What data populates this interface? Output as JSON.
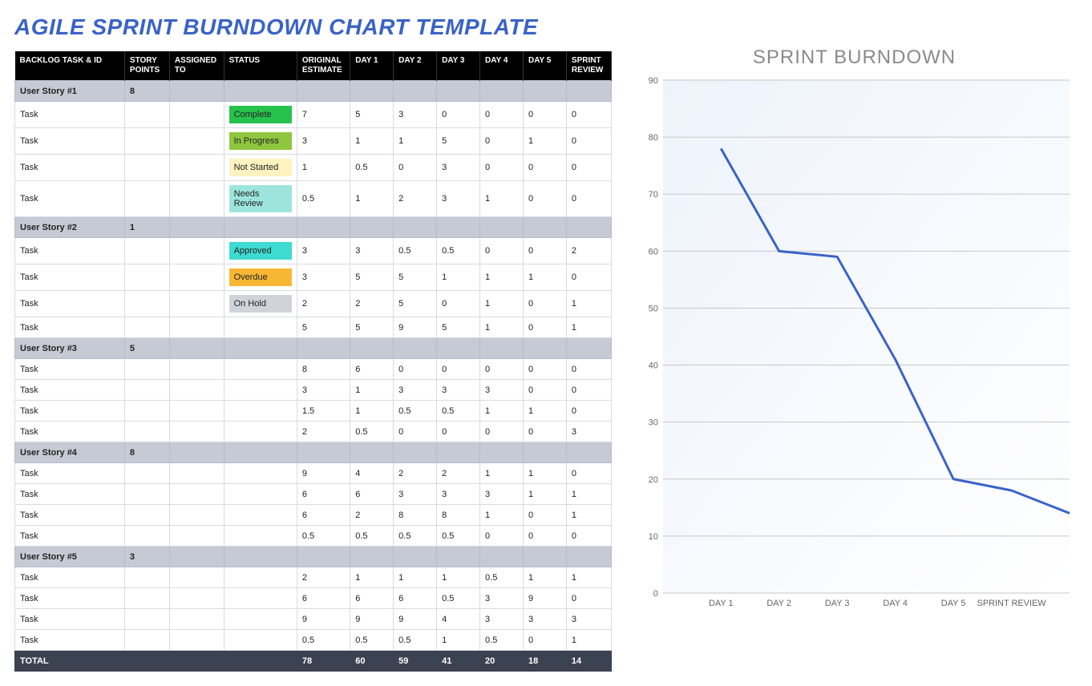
{
  "title": "AGILE SPRINT BURNDOWN CHART TEMPLATE",
  "columns": [
    "BACKLOG TASK & ID",
    "STORY POINTS",
    "ASSIGNED TO",
    "STATUS",
    "ORIGINAL ESTIMATE",
    "DAY 1",
    "DAY 2",
    "DAY 3",
    "DAY 4",
    "DAY 5",
    "SPRINT REVIEW"
  ],
  "status_colors": {
    "Complete": "#27c24c",
    "In Progress": "#8ec63f",
    "Not Started": "#fdf2c0",
    "Needs Review": "#9de5dc",
    "Approved": "#3ddbd1",
    "Overdue": "#f7b733",
    "On Hold": "#d0d3d9"
  },
  "rows": [
    {
      "type": "story",
      "name": "User Story #1",
      "points": "8"
    },
    {
      "type": "task",
      "name": "Task",
      "status": "Complete",
      "vals": [
        "7",
        "5",
        "3",
        "0",
        "0",
        "0",
        "0"
      ]
    },
    {
      "type": "task",
      "name": "Task",
      "status": "In Progress",
      "vals": [
        "3",
        "1",
        "1",
        "5",
        "0",
        "1",
        "0"
      ]
    },
    {
      "type": "task",
      "name": "Task",
      "status": "Not Started",
      "vals": [
        "1",
        "0.5",
        "0",
        "3",
        "0",
        "0",
        "0"
      ]
    },
    {
      "type": "task",
      "name": "Task",
      "status": "Needs Review",
      "vals": [
        "0.5",
        "1",
        "2",
        "3",
        "1",
        "0",
        "0"
      ]
    },
    {
      "type": "story",
      "name": "User Story #2",
      "points": "1"
    },
    {
      "type": "task",
      "name": "Task",
      "status": "Approved",
      "vals": [
        "3",
        "3",
        "0.5",
        "0.5",
        "0",
        "0",
        "2"
      ]
    },
    {
      "type": "task",
      "name": "Task",
      "status": "Overdue",
      "vals": [
        "3",
        "5",
        "5",
        "1",
        "1",
        "1",
        "0"
      ]
    },
    {
      "type": "task",
      "name": "Task",
      "status": "On Hold",
      "vals": [
        "2",
        "2",
        "5",
        "0",
        "1",
        "0",
        "1"
      ]
    },
    {
      "type": "task",
      "name": "Task",
      "status": "",
      "vals": [
        "5",
        "5",
        "9",
        "5",
        "1",
        "0",
        "1"
      ]
    },
    {
      "type": "story",
      "name": "User Story #3",
      "points": "5"
    },
    {
      "type": "task",
      "name": "Task",
      "status": "",
      "vals": [
        "8",
        "6",
        "0",
        "0",
        "0",
        "0",
        "0"
      ]
    },
    {
      "type": "task",
      "name": "Task",
      "status": "",
      "vals": [
        "3",
        "1",
        "3",
        "3",
        "3",
        "0",
        "0"
      ]
    },
    {
      "type": "task",
      "name": "Task",
      "status": "",
      "vals": [
        "1.5",
        "1",
        "0.5",
        "0.5",
        "1",
        "1",
        "0"
      ]
    },
    {
      "type": "task",
      "name": "Task",
      "status": "",
      "vals": [
        "2",
        "0.5",
        "0",
        "0",
        "0",
        "0",
        "3"
      ]
    },
    {
      "type": "story",
      "name": "User Story #4",
      "points": "8"
    },
    {
      "type": "task",
      "name": "Task",
      "status": "",
      "vals": [
        "9",
        "4",
        "2",
        "2",
        "1",
        "1",
        "0"
      ]
    },
    {
      "type": "task",
      "name": "Task",
      "status": "",
      "vals": [
        "6",
        "6",
        "3",
        "3",
        "3",
        "1",
        "1"
      ]
    },
    {
      "type": "task",
      "name": "Task",
      "status": "",
      "vals": [
        "6",
        "2",
        "8",
        "8",
        "1",
        "0",
        "1"
      ]
    },
    {
      "type": "task",
      "name": "Task",
      "status": "",
      "vals": [
        "0.5",
        "0.5",
        "0.5",
        "0.5",
        "0",
        "0",
        "0"
      ]
    },
    {
      "type": "story",
      "name": "User Story #5",
      "points": "3"
    },
    {
      "type": "task",
      "name": "Task",
      "status": "",
      "vals": [
        "2",
        "1",
        "1",
        "1",
        "0.5",
        "1",
        "1"
      ]
    },
    {
      "type": "task",
      "name": "Task",
      "status": "",
      "vals": [
        "6",
        "6",
        "6",
        "0.5",
        "3",
        "9",
        "0"
      ]
    },
    {
      "type": "task",
      "name": "Task",
      "status": "",
      "vals": [
        "9",
        "9",
        "9",
        "4",
        "3",
        "3",
        "3"
      ]
    },
    {
      "type": "task",
      "name": "Task",
      "status": "",
      "vals": [
        "0.5",
        "0.5",
        "0.5",
        "1",
        "0.5",
        "0",
        "1"
      ]
    }
  ],
  "total": {
    "label": "TOTAL",
    "vals": [
      "78",
      "60",
      "59",
      "41",
      "20",
      "18",
      "14"
    ]
  },
  "chart_title": "SPRINT BURNDOWN",
  "chart_data": {
    "type": "line",
    "title": "SPRINT BURNDOWN",
    "categories": [
      "",
      "DAY 1",
      "DAY 2",
      "DAY 3",
      "DAY 4",
      "DAY 5",
      "SPRINT REVIEW",
      ""
    ],
    "series": [
      {
        "name": "Burndown",
        "values": [
          null,
          78,
          60,
          59,
          41,
          20,
          18,
          14
        ]
      }
    ],
    "ylim": [
      0,
      90
    ],
    "yticks": [
      0,
      10,
      20,
      30,
      40,
      50,
      60,
      70,
      80,
      90
    ],
    "xlabel": "",
    "ylabel": ""
  }
}
